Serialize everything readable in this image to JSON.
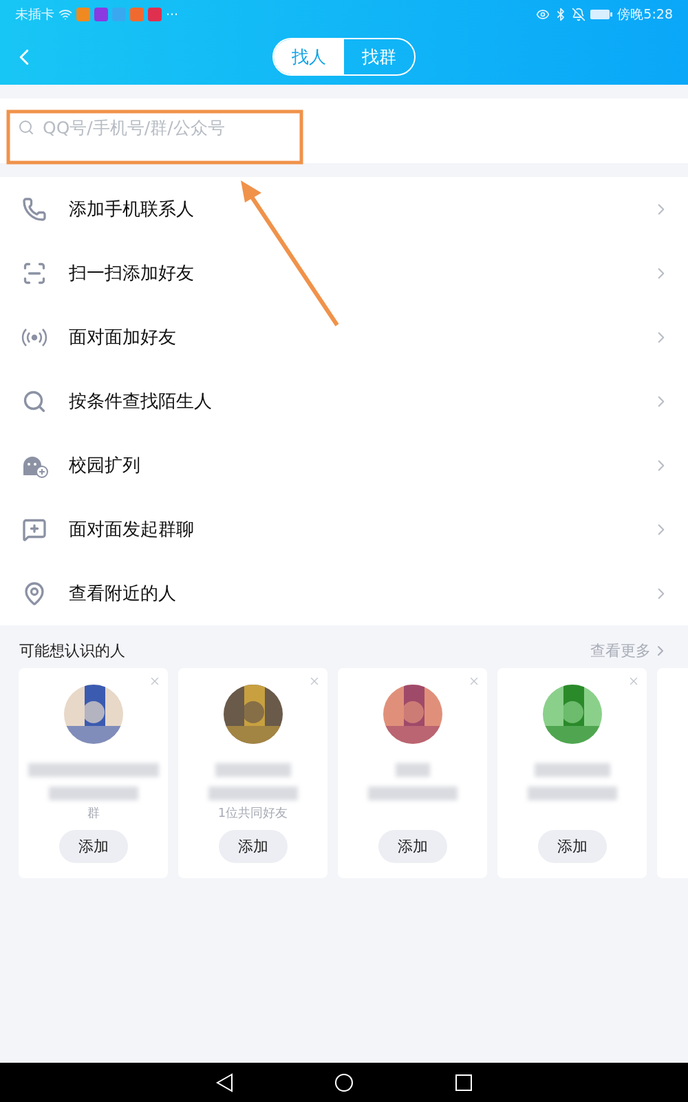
{
  "status_bar": {
    "carrier": "未插卡",
    "more": "···",
    "time": "傍晚5:28"
  },
  "header": {
    "tabs": [
      {
        "label": "找人",
        "selected": true
      },
      {
        "label": "找群",
        "selected": false
      }
    ]
  },
  "search": {
    "placeholder": "QQ号/手机号/群/公众号"
  },
  "menu": [
    {
      "label": "添加手机联系人"
    },
    {
      "label": "扫一扫添加好友"
    },
    {
      "label": "面对面加好友"
    },
    {
      "label": "按条件查找陌生人"
    },
    {
      "label": "校园扩列"
    },
    {
      "label": "面对面发起群聊"
    },
    {
      "label": "查看附近的人"
    }
  ],
  "suggestions": {
    "title": "可能想认识的人",
    "more": "查看更多",
    "cards": [
      {
        "note": "群",
        "button": "添加"
      },
      {
        "note": "1位共同好友",
        "button": "添加"
      },
      {
        "button": "添加"
      },
      {
        "button": "添加"
      }
    ]
  }
}
